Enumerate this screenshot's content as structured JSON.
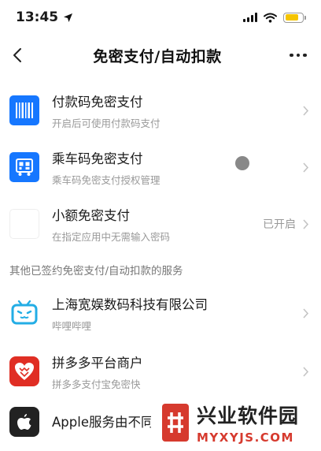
{
  "status_bar": {
    "time": "13:45"
  },
  "nav": {
    "title": "免密支付/自动扣款"
  },
  "rows": [
    {
      "title": "付款码免密支付",
      "subtitle": "开启后可使用付款码支付",
      "status": ""
    },
    {
      "title": "乘车码免密支付",
      "subtitle": "乘车码免密支付授权管理",
      "status": ""
    },
    {
      "title": "小额免密支付",
      "subtitle": "在指定应用中无需输入密码",
      "status": "已开启"
    }
  ],
  "section": {
    "header": "其他已签约免密支付/自动扣款的服务"
  },
  "services": [
    {
      "title": "上海宽娱数码科技有限公司",
      "subtitle": "哔哩哔哩"
    },
    {
      "title": "拼多多平台商户",
      "subtitle": "拼多多支付宝免密快"
    },
    {
      "title": "Apple服务由不同",
      "subtitle": ""
    }
  ],
  "watermark": {
    "title": "兴业软件园",
    "url": "MYXYJS.COM"
  },
  "colors": {
    "accent_blue": "#1677ff",
    "bilibili": "#23ade5",
    "pdd_red": "#e02e24",
    "watermark_red": "#d63a2e"
  }
}
